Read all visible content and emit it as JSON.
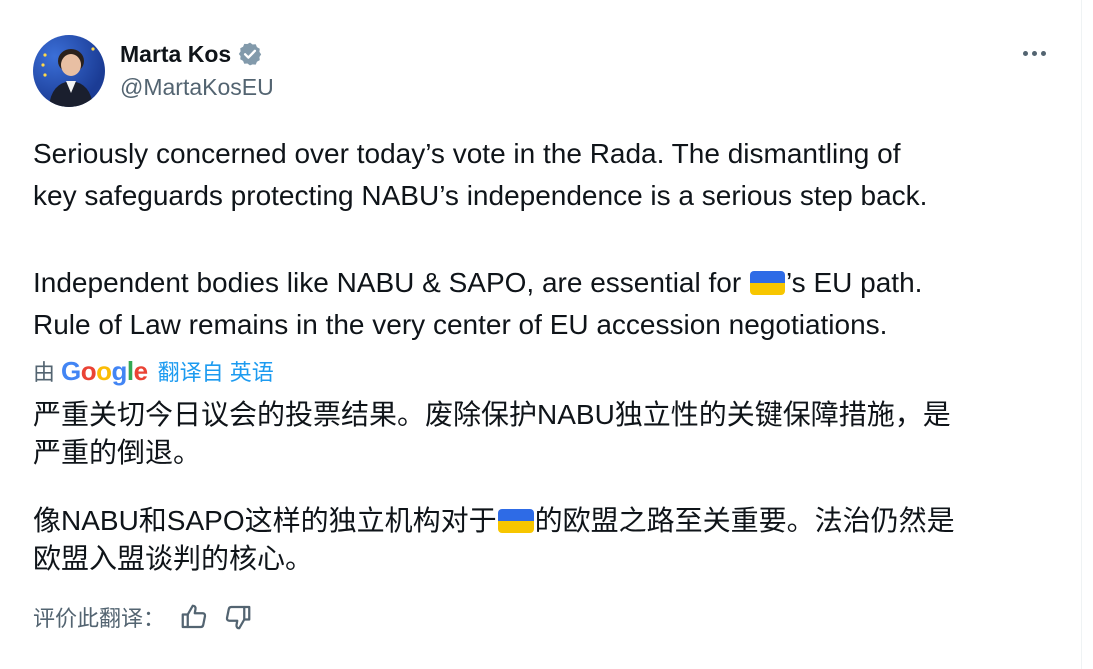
{
  "author": {
    "name": "Marta Kos",
    "handle": "@MartaKosEU"
  },
  "tweet": {
    "original_line1": "Seriously concerned over today’s vote in the Rada. The dismantling of",
    "original_line2": "key safeguards protecting NABU’s independence is a serious step back.",
    "original_line3_pre": "Independent bodies like NABU & SAPO, are essential for ",
    "original_line3_post": "’s EU path.",
    "original_line4": "Rule of Law remains in the very center of EU accession negotiations."
  },
  "translation": {
    "by_label": "由",
    "provider_parts": [
      "G",
      "o",
      "o",
      "g",
      "l",
      "e"
    ],
    "source_link": "翻译自 英语",
    "line1": "严重关切今日议会的投票结果。废除保护NABU独立性的关键保障措施，是",
    "line2": "严重的倒退。",
    "line3_pre": "像NABU和SAPO这样的独立机构对于",
    "line3_post": "的欧盟之路至关重要。法治仍然是",
    "line4": "欧盟入盟谈判的核心。"
  },
  "rating": {
    "label": "评价此翻译："
  },
  "icons": {
    "verified": "verified-badge-icon",
    "more": "more-options-icon",
    "flag": "ukraine-flag-icon",
    "thumbs_up": "thumbs-up-icon",
    "thumbs_down": "thumbs-down-icon"
  },
  "colors": {
    "text": "#0f1419",
    "secondary": "#536471",
    "link": "#1d9bf0",
    "flag_blue": "#2e6be6",
    "flag_yellow": "#f7c600"
  }
}
